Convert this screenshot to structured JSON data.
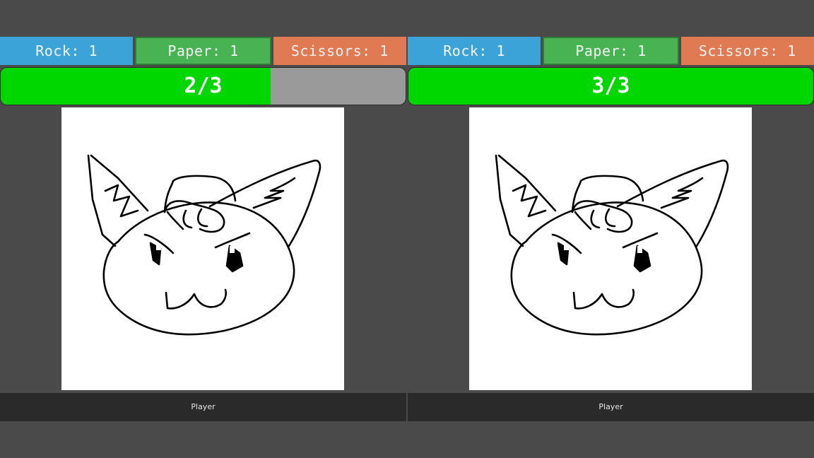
{
  "colors": {
    "background": "#4a4a4a",
    "rock": "#3ba3d8",
    "paper": "#47b352",
    "scissors": "#e07a52",
    "progress_fill": "#00d700",
    "progress_empty": "#9a9a9a",
    "player_bar": "#2a2a2a"
  },
  "left": {
    "rock_label": "Rock: 1",
    "paper_label": "Paper: 1",
    "scissors_label": "Scissors: 1",
    "progress_text": "2/3",
    "progress_fraction": 0.667,
    "drawing_icon": "cat-face-doodle-icon",
    "player_label": "Player"
  },
  "right": {
    "rock_label": "Rock: 1",
    "paper_label": "Paper: 1",
    "scissors_label": "Scissors: 1",
    "progress_text": "3/3",
    "progress_fraction": 1.0,
    "drawing_icon": "cat-face-doodle-icon",
    "player_label": "Player"
  }
}
